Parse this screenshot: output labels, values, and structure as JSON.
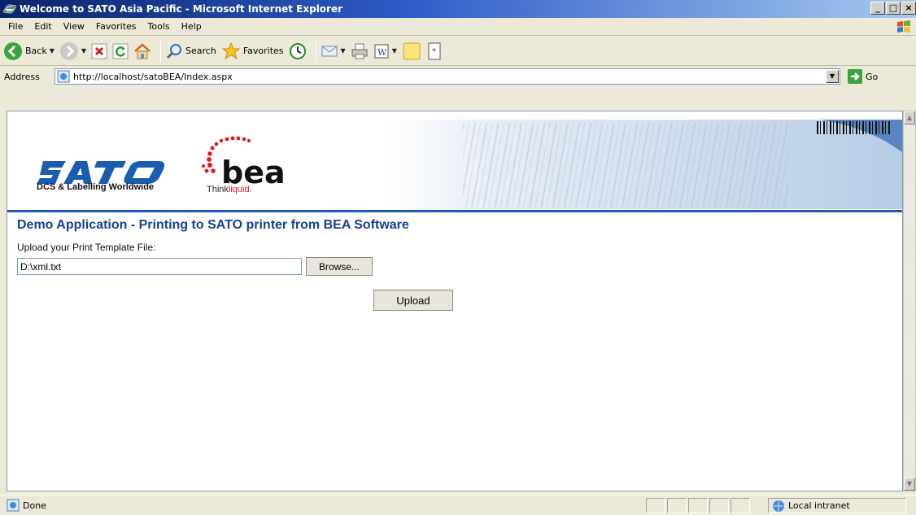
{
  "window": {
    "title": "Welcome to SATO Asia Pacific - Microsoft Internet Explorer",
    "minimize": "_",
    "maximize": "□",
    "close": "×"
  },
  "menu": [
    "File",
    "Edit",
    "View",
    "Favorites",
    "Tools",
    "Help"
  ],
  "toolbar": {
    "back": "Back",
    "search": "Search",
    "favorites": "Favorites"
  },
  "address": {
    "label": "Address",
    "url": "http://localhost/satoBEA/Index.aspx",
    "go": "Go"
  },
  "page": {
    "sato_tagline": "DCS & Labelling Worldwide",
    "bea_think": "Think",
    "bea_liquid": "liquid.",
    "title": "Demo Application - Printing to SATO printer from BEA Software",
    "upload_label": "Upload your Print Template File:",
    "file_value": "D:\\xml.txt",
    "browse_label": "Browse...",
    "upload_button": "Upload"
  },
  "status": {
    "text": "Done",
    "zone": "Local intranet"
  },
  "colors": {
    "title_blue": "#1a3f8f",
    "banner_line": "#1a5cb0",
    "sato_blue": "#1a5cb0",
    "bea_red": "#e01a1a"
  }
}
